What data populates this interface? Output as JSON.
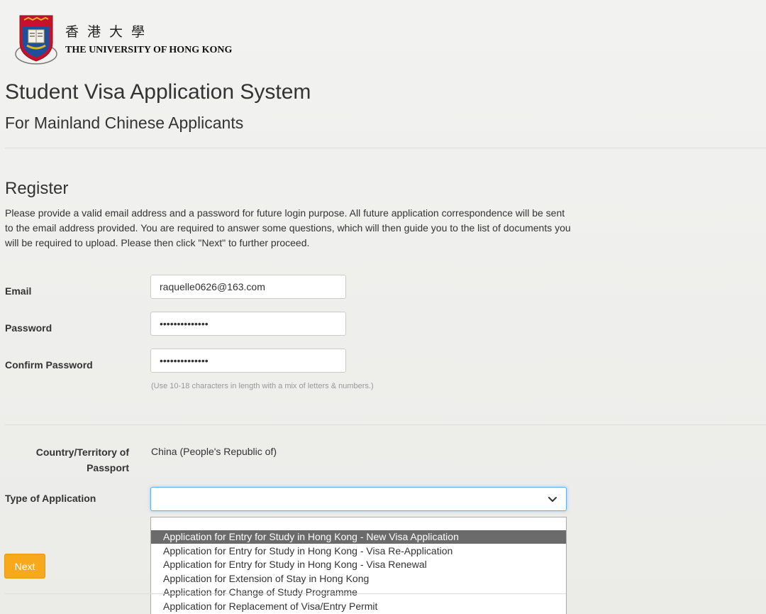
{
  "header": {
    "logo_zh": "香港大學",
    "logo_en": "THE UNIVERSITY OF HONG KONG"
  },
  "page": {
    "title": "Student Visa Application System",
    "subtitle": "For Mainland Chinese Applicants"
  },
  "register": {
    "heading": "Register",
    "intro": "Please provide a valid email address and a password for future login purpose. All future application correspondence will be sent to the email address provided. You are required to answer some questions, which will then guide you to the list of documents you will be required to upload. Please then click \"Next\" to further proceed."
  },
  "form": {
    "email_label": "Email",
    "email_value": "raquelle0626@163.com",
    "password_label": "Password",
    "password_value": "••••••••••••••",
    "confirm_label": "Confirm Password",
    "confirm_value": "••••••••••••••",
    "password_hint": "(Use 10-18 characters in length with a mix of letters & numbers.)",
    "country_label": "Country/Territory of Passport",
    "country_value": "China (People's Republic of)",
    "type_label": "Type of Application",
    "type_value": "",
    "type_options": [
      "Application for Entry for Study in Hong Kong - New Visa Application",
      "Application for Entry for Study in Hong Kong - Visa Re-Application",
      "Application for Entry for Study in Hong Kong - Visa Renewal",
      "Application for Extension of Stay in Hong Kong",
      "Application for Change of Study Programme",
      "Application for Replacement of Visa/Entry Permit"
    ],
    "highlighted_option_index": 0,
    "next_label": "Next"
  },
  "colors": {
    "accent_button": "#f7a81b",
    "focus_border": "#66afe9",
    "highlight_option": "#6b6b6b",
    "crest_red": "#c8102e",
    "crest_blue": "#1f4e9c",
    "crest_gold": "#e0b22c"
  },
  "icons": {
    "crest": "university-crest-icon",
    "select_arrow": "chevron-down-icon"
  }
}
